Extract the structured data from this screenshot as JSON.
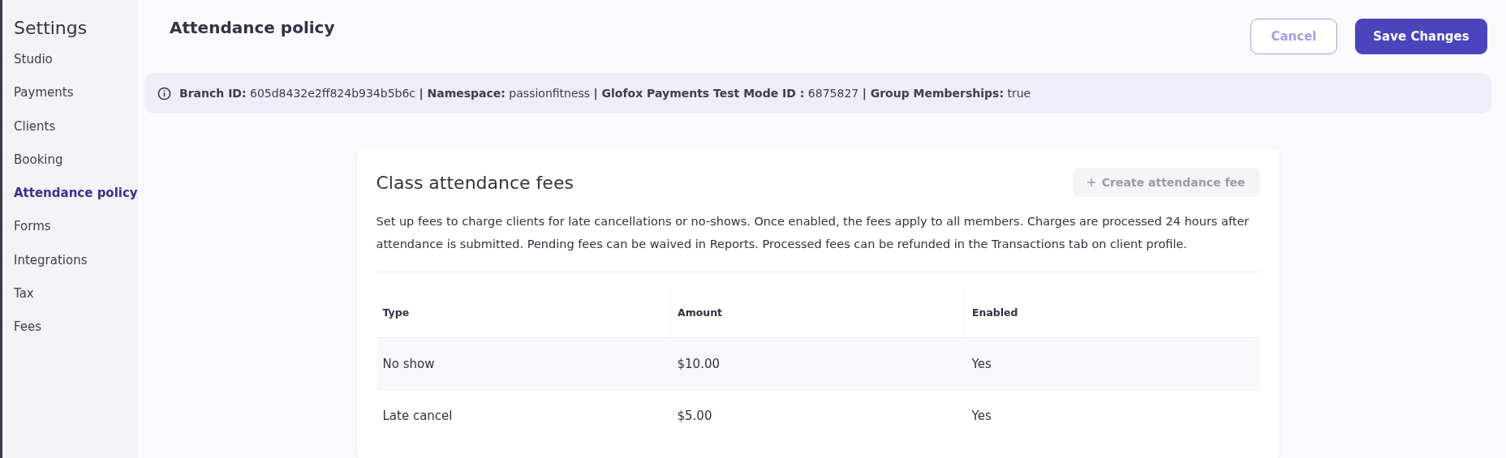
{
  "sidebar": {
    "title": "Settings",
    "items": [
      {
        "label": "Studio",
        "selected": false
      },
      {
        "label": "Payments",
        "selected": false
      },
      {
        "label": "Clients",
        "selected": false
      },
      {
        "label": "Booking",
        "selected": false
      },
      {
        "label": "Attendance policy",
        "selected": true
      },
      {
        "label": "Forms",
        "selected": false
      },
      {
        "label": "Integrations",
        "selected": false
      },
      {
        "label": "Tax",
        "selected": false
      },
      {
        "label": "Fees",
        "selected": false
      }
    ]
  },
  "header": {
    "title": "Attendance policy",
    "buttons": [
      {
        "label": "Cancel",
        "kind": "secondary"
      },
      {
        "label": "Save Changes",
        "kind": "primary"
      }
    ]
  },
  "info_bar": {
    "text": "**Branch ID:** 605d8432e2ff824b934b5b6c **| Namespace:** passionfitness **| Glofox Payments Test Mode ID :** 6875827 **| Group Memberships:** true"
  },
  "card": {
    "title": "Class attendance fees",
    "create_button": {
      "label": "Create attendance fee",
      "disabled": true
    },
    "description": "Set up fees to charge clients for late cancellations or no-shows. Once enabled, the fees apply to all members. Charges are processed 24 hours after attendance is submitted. Pending fees can be waived in Reports. Processed fees can be refunded in the Transactions tab on client profile.",
    "table": {
      "columns": [
        "Type",
        "Amount",
        "Enabled"
      ],
      "rows": [
        [
          "No show",
          "$10.00",
          "Yes"
        ],
        [
          "Late cancel",
          "$5.00",
          "Yes"
        ]
      ]
    }
  }
}
